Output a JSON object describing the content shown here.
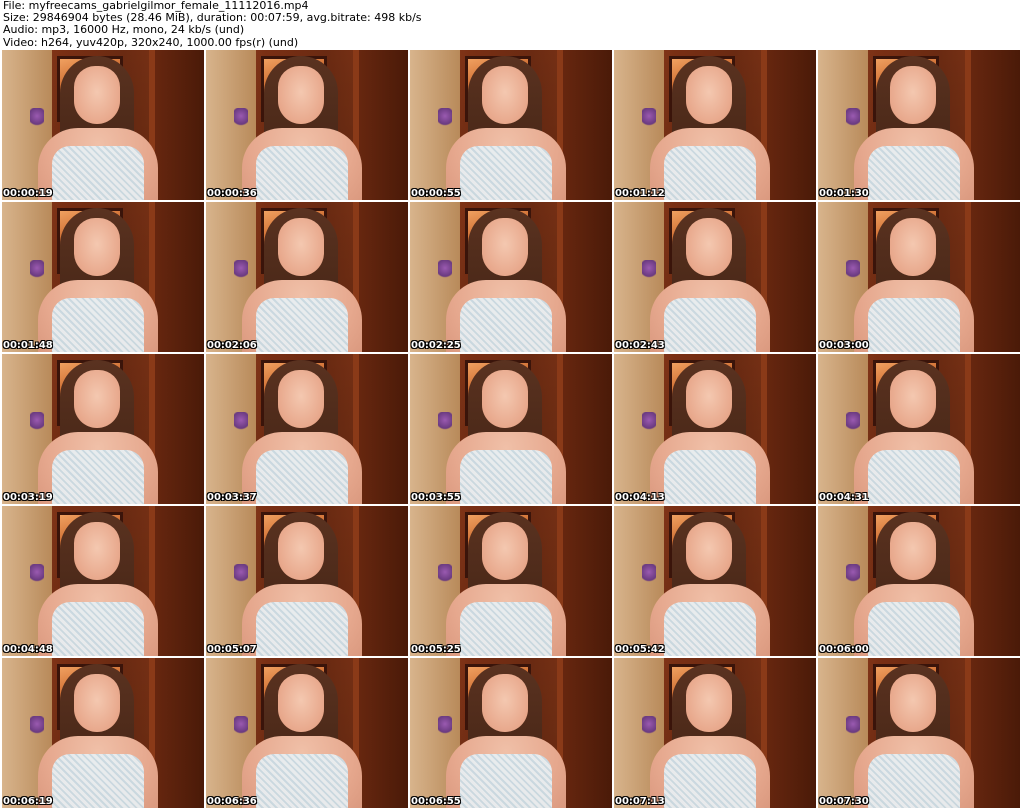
{
  "header": {
    "file_line": "File: myfreecams_gabrielgilmor_female_11112016.mp4",
    "size_line": "Size: 29846904 bytes (28.46 MiB), duration: 00:07:59, avg.bitrate: 498 kb/s",
    "audio_line": "Audio: mp3, 16000 Hz, mono, 24 kb/s (und)",
    "video_line": "Video: h264, yuv420p, 320x240, 1000.00 fps(r) (und)"
  },
  "thumbnails": [
    {
      "timestamp": "00:00:19"
    },
    {
      "timestamp": "00:00:36"
    },
    {
      "timestamp": "00:00:55"
    },
    {
      "timestamp": "00:01:12"
    },
    {
      "timestamp": "00:01:30"
    },
    {
      "timestamp": "00:01:48"
    },
    {
      "timestamp": "00:02:06"
    },
    {
      "timestamp": "00:02:25"
    },
    {
      "timestamp": "00:02:43"
    },
    {
      "timestamp": "00:03:00"
    },
    {
      "timestamp": "00:03:19"
    },
    {
      "timestamp": "00:03:37"
    },
    {
      "timestamp": "00:03:55"
    },
    {
      "timestamp": "00:04:13"
    },
    {
      "timestamp": "00:04:31"
    },
    {
      "timestamp": "00:04:48"
    },
    {
      "timestamp": "00:05:07"
    },
    {
      "timestamp": "00:05:25"
    },
    {
      "timestamp": "00:05:42"
    },
    {
      "timestamp": "00:06:00"
    },
    {
      "timestamp": "00:06:19"
    },
    {
      "timestamp": "00:06:36"
    },
    {
      "timestamp": "00:06:55"
    },
    {
      "timestamp": "00:07:13"
    },
    {
      "timestamp": "00:07:30"
    }
  ]
}
